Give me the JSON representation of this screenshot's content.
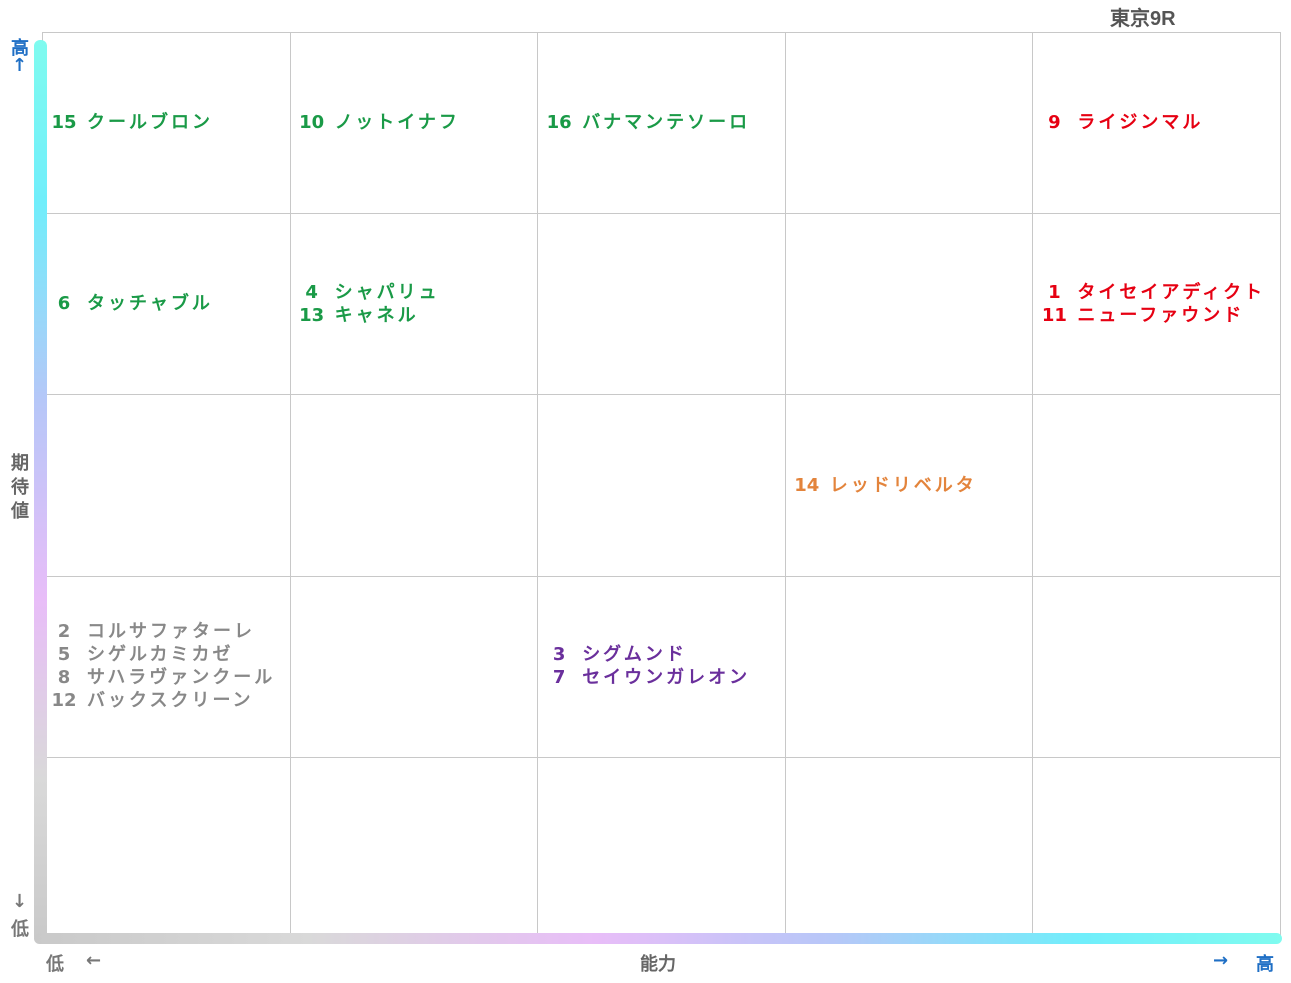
{
  "title": "東京9R",
  "axes": {
    "y_name_chars": [
      "期",
      "待",
      "値"
    ],
    "y_high": "高",
    "y_high_arrow": "↑",
    "y_low": "低",
    "y_low_arrow": "↓",
    "x_name": "能力",
    "x_low": "低",
    "x_low_arrow": "←",
    "x_high": "高",
    "x_high_arrow": "→"
  },
  "colors": {
    "green": "#1a9a47",
    "red": "#e60012",
    "orange": "#e3843c",
    "gray": "#888888",
    "purple": "#6a2f9c"
  },
  "grid": {
    "columns": 5,
    "rows": 5
  },
  "cells": [
    {
      "col": 0,
      "row": 0,
      "color": "green",
      "horses": [
        {
          "num": "15",
          "name": "クールブロン"
        }
      ]
    },
    {
      "col": 1,
      "row": 0,
      "color": "green",
      "horses": [
        {
          "num": "10",
          "name": "ノットイナフ"
        }
      ]
    },
    {
      "col": 2,
      "row": 0,
      "color": "green",
      "horses": [
        {
          "num": "16",
          "name": "バナマンテソーロ"
        }
      ]
    },
    {
      "col": 4,
      "row": 0,
      "color": "red",
      "horses": [
        {
          "num": "9",
          "name": "ライジンマル"
        }
      ]
    },
    {
      "col": 0,
      "row": 1,
      "color": "green",
      "horses": [
        {
          "num": "6",
          "name": "タッチャブル"
        }
      ]
    },
    {
      "col": 1,
      "row": 1,
      "color": "green",
      "horses": [
        {
          "num": "4",
          "name": "シャパリュ"
        },
        {
          "num": "13",
          "name": "キャネル"
        }
      ]
    },
    {
      "col": 4,
      "row": 1,
      "color": "red",
      "horses": [
        {
          "num": "1",
          "name": "タイセイアディクト"
        },
        {
          "num": "11",
          "name": "ニューファウンド"
        }
      ]
    },
    {
      "col": 3,
      "row": 2,
      "color": "orange",
      "horses": [
        {
          "num": "14",
          "name": "レッドリベルタ"
        }
      ]
    },
    {
      "col": 0,
      "row": 3,
      "color": "gray",
      "horses": [
        {
          "num": "2",
          "name": "コルサファターレ"
        },
        {
          "num": "5",
          "name": "シゲルカミカゼ"
        },
        {
          "num": "8",
          "name": "サハラヴァンクール"
        },
        {
          "num": "12",
          "name": "バックスクリーン"
        }
      ]
    },
    {
      "col": 2,
      "row": 3,
      "color": "purple",
      "horses": [
        {
          "num": "3",
          "name": "シグムンド"
        },
        {
          "num": "7",
          "name": "セイウンガレオン"
        }
      ]
    }
  ]
}
